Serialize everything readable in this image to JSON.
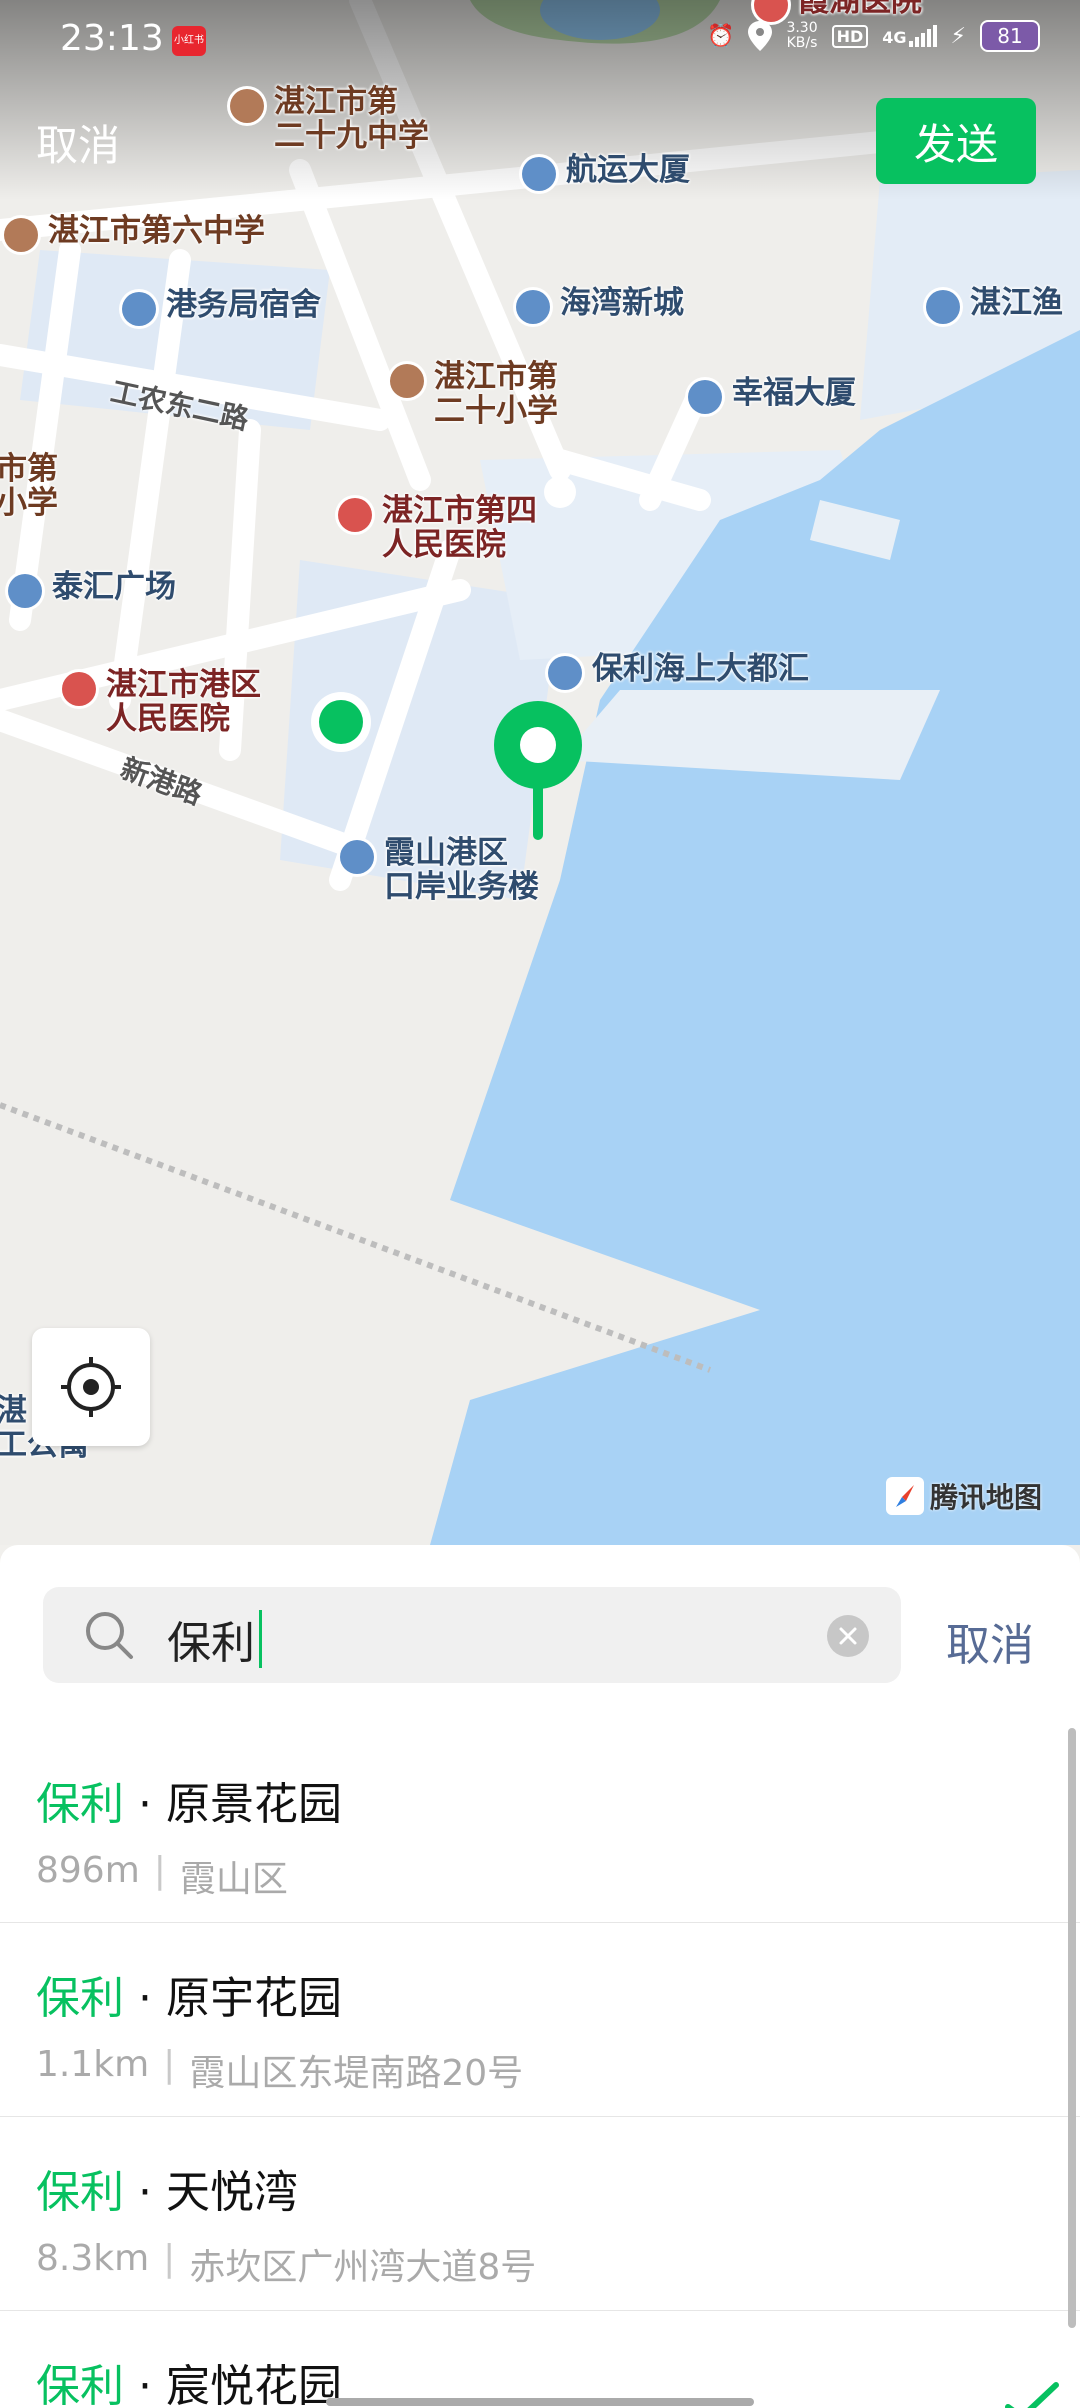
{
  "status_bar": {
    "time": "23:13",
    "app_badge": "小红书",
    "net_speed_value": "3.30",
    "net_speed_unit": "KB/s",
    "hd": "HD",
    "network": "4G",
    "battery": "81"
  },
  "header": {
    "cancel_label": "取消",
    "send_label": "发送"
  },
  "map": {
    "pois": {
      "p1": "湛江市第\n二十九中学",
      "p2": "航运大厦",
      "p3": "湛江市第六中学",
      "p4": "港务局宿舍",
      "p5": "海湾新城",
      "p6": "湛江渔",
      "p7": "湛江市第\n二十小学",
      "p8": "幸福大厦",
      "p9": "湛江市第四\n人民医院",
      "p10": "泰汇广场",
      "p11": "保利海上大都汇",
      "p12": "湛江市港区\n人民医院",
      "p13": "霞山港区\n口岸业务楼",
      "p14": "霞湖医院",
      "p15": "市第\n小学",
      "p16": "湛\n工公寓"
    },
    "roads": {
      "r1": "工农东二路",
      "r2": "新港路"
    },
    "attribution": "腾讯地图",
    "accent_color": "#07c160",
    "water_color": "#a8d2f5"
  },
  "search": {
    "query": "保利",
    "cancel_label": "取消"
  },
  "results": [
    {
      "highlight": "保利",
      "name": " · 原景花园",
      "distance": "896m",
      "sep": "|",
      "address": "霞山区"
    },
    {
      "highlight": "保利",
      "name": " · 原宇花园",
      "distance": "1.1km",
      "sep": "|",
      "address": "霞山区东堤南路20号"
    },
    {
      "highlight": "保利",
      "name": " · 天悦湾",
      "distance": "8.3km",
      "sep": "|",
      "address": "赤坎区广州湾大道8号"
    },
    {
      "highlight": "保利",
      "name": " · 宸悦花园",
      "distance": "",
      "sep": "",
      "address": ""
    }
  ]
}
